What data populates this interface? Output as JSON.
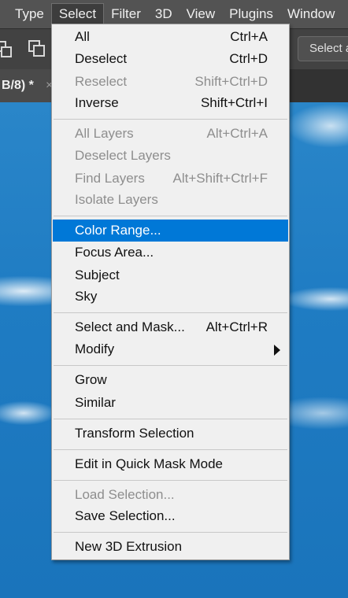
{
  "menubar": {
    "items": [
      {
        "label": "Type"
      },
      {
        "label": "Select"
      },
      {
        "label": "Filter"
      },
      {
        "label": "3D"
      },
      {
        "label": "View"
      },
      {
        "label": "Plugins"
      },
      {
        "label": "Window"
      }
    ],
    "active": "Select"
  },
  "optionsbar": {
    "select_subject_label": "Select a"
  },
  "document": {
    "tab_title": "B/8) *",
    "close_glyph": "×"
  },
  "select_menu": {
    "items": [
      {
        "label": "All",
        "shortcut": "Ctrl+A",
        "enabled": true
      },
      {
        "label": "Deselect",
        "shortcut": "Ctrl+D",
        "enabled": true
      },
      {
        "label": "Reselect",
        "shortcut": "Shift+Ctrl+D",
        "enabled": false
      },
      {
        "label": "Inverse",
        "shortcut": "Shift+Ctrl+I",
        "enabled": true
      },
      {
        "label": "All Layers",
        "shortcut": "Alt+Ctrl+A",
        "enabled": false
      },
      {
        "label": "Deselect Layers",
        "shortcut": "",
        "enabled": false
      },
      {
        "label": "Find Layers",
        "shortcut": "Alt+Shift+Ctrl+F",
        "enabled": false
      },
      {
        "label": "Isolate Layers",
        "shortcut": "",
        "enabled": false
      },
      {
        "label": "Color Range...",
        "shortcut": "",
        "enabled": true,
        "highlighted": true
      },
      {
        "label": "Focus Area...",
        "shortcut": "",
        "enabled": true
      },
      {
        "label": "Subject",
        "shortcut": "",
        "enabled": true
      },
      {
        "label": "Sky",
        "shortcut": "",
        "enabled": true
      },
      {
        "label": "Select and Mask...",
        "shortcut": "Alt+Ctrl+R",
        "enabled": true
      },
      {
        "label": "Modify",
        "shortcut": "",
        "enabled": true,
        "submenu": true
      },
      {
        "label": "Grow",
        "shortcut": "",
        "enabled": true
      },
      {
        "label": "Similar",
        "shortcut": "",
        "enabled": true
      },
      {
        "label": "Transform Selection",
        "shortcut": "",
        "enabled": true
      },
      {
        "label": "Edit in Quick Mask Mode",
        "shortcut": "",
        "enabled": true
      },
      {
        "label": "Load Selection...",
        "shortcut": "",
        "enabled": false
      },
      {
        "label": "Save Selection...",
        "shortcut": "",
        "enabled": true
      },
      {
        "label": "New 3D Extrusion",
        "shortcut": "",
        "enabled": true
      }
    ]
  },
  "colors": {
    "highlight": "#0078d7",
    "menu_bg": "#f0f0f0",
    "disabled_text": "#8e8e8e",
    "menubar_bg": "#535353"
  }
}
